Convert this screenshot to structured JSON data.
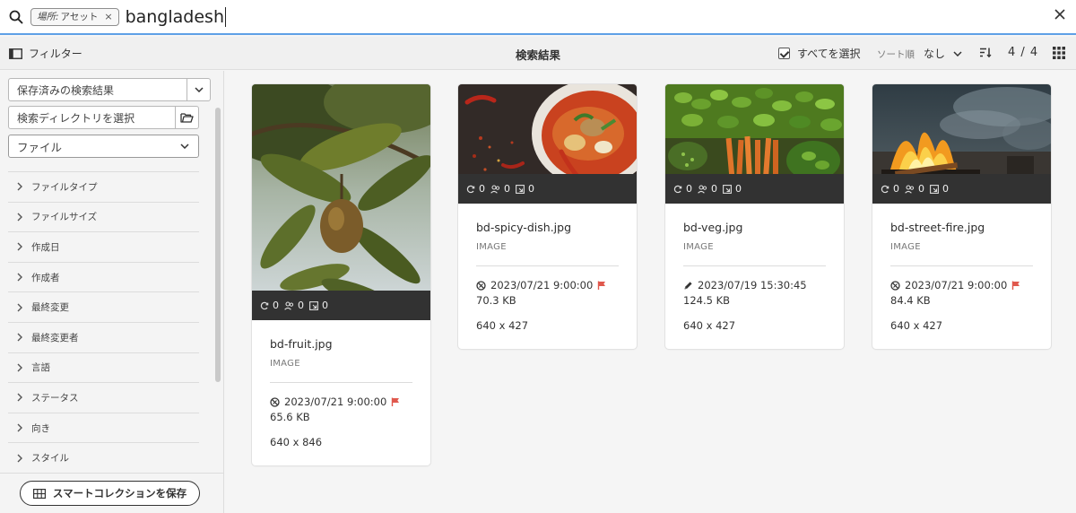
{
  "search": {
    "tag_label": "場所:",
    "tag_value": "アセット",
    "tag_remove": "×",
    "query": "bangladesh"
  },
  "toolbar": {
    "filter_label": "フィルター",
    "title": "検索結果",
    "select_all": "すべてを選択",
    "sort_label": "ソート順",
    "sort_value": "なし",
    "count": "4 / 4"
  },
  "sidebar": {
    "saved_search_placeholder": "保存済みの検索結果",
    "directory_placeholder": "検索ディレクトリを選択",
    "type_select": "ファイル",
    "facets": [
      "ファイルタイプ",
      "ファイルサイズ",
      "作成日",
      "作成者",
      "最終変更",
      "最終変更者",
      "言語",
      "ステータス",
      "向き",
      "スタイル"
    ],
    "smart_collection_button": "スマートコレクションを保存"
  },
  "results": [
    {
      "name": "bd-fruit.jpg",
      "type": "IMAGE",
      "stats": [
        "0",
        "0",
        "0"
      ],
      "date": "2023/07/21 9:00:00",
      "date_icon": "unpublished-icon",
      "flagged": true,
      "size": "65.6 KB",
      "dimensions": "640 x 846"
    },
    {
      "name": "bd-spicy-dish.jpg",
      "type": "IMAGE",
      "stats": [
        "0",
        "0",
        "0"
      ],
      "date": "2023/07/21 9:00:00",
      "date_icon": "unpublished-icon",
      "flagged": true,
      "size": "70.3 KB",
      "dimensions": "640 x 427"
    },
    {
      "name": "bd-veg.jpg",
      "type": "IMAGE",
      "stats": [
        "0",
        "0",
        "0"
      ],
      "date": "2023/07/19 15:30:45",
      "date_icon": "edit-icon",
      "flagged": false,
      "size": "124.5 KB",
      "dimensions": "640 x 427"
    },
    {
      "name": "bd-street-fire.jpg",
      "type": "IMAGE",
      "stats": [
        "0",
        "0",
        "0"
      ],
      "date": "2023/07/21 9:00:00",
      "date_icon": "unpublished-icon",
      "flagged": true,
      "size": "84.4 KB",
      "dimensions": "640 x 427"
    }
  ],
  "colors": {
    "accent": "#5ea0e6",
    "flag": "#e0584d",
    "stats_bar": "#323232"
  }
}
